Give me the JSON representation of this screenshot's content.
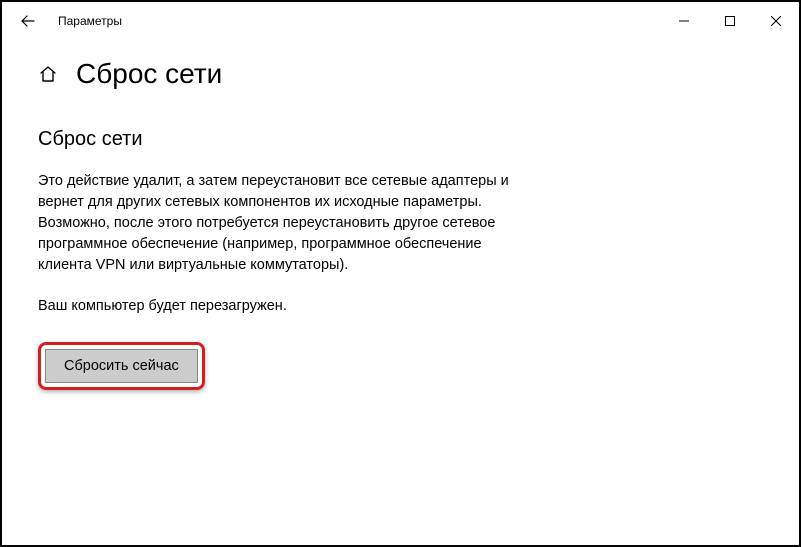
{
  "titlebar": {
    "title": "Параметры"
  },
  "header": {
    "page_title": "Сброс сети"
  },
  "content": {
    "section_title": "Сброс сети",
    "description": "Это действие удалит, а затем переустановит все сетевые адаптеры и вернет для других сетевых компонентов их исходные параметры. Возможно, после этого потребуется переустановить другое сетевое программное обеспечение (например, программное обеспечение клиента VPN или виртуальные коммутаторы).",
    "restart_note": "Ваш компьютер будет перезагружен.",
    "reset_button_label": "Сбросить сейчас"
  }
}
